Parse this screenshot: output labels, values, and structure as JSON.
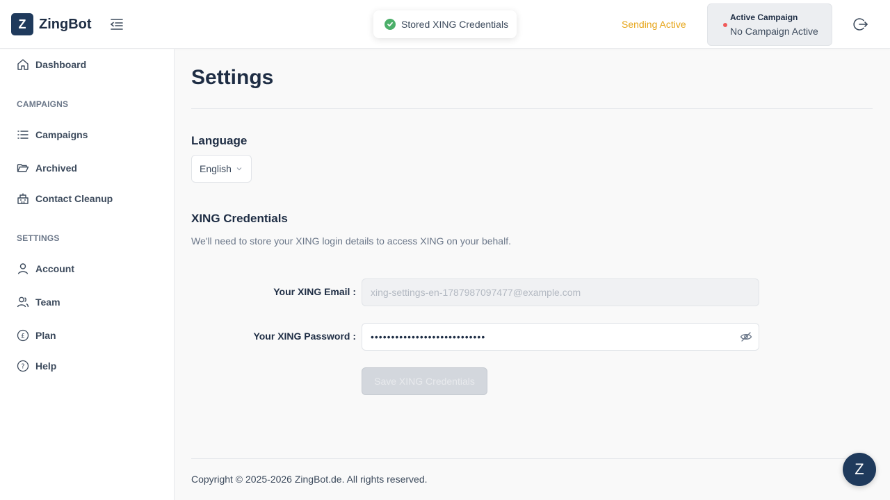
{
  "app": {
    "logo_letter": "Z",
    "name": "ZingBot"
  },
  "toast": {
    "message": "Stored XING Credentials",
    "icon": "check-circle-icon",
    "color": "#4caf6a"
  },
  "header": {
    "status": "Sending Active",
    "status_color": "#e6a417",
    "campaign_title": "Active Campaign",
    "campaign_value": "No Campaign Active",
    "campaign_dot_color": "#f05a5a"
  },
  "sidebar": {
    "dashboard": "Dashboard",
    "campaigns_section": "CAMPAIGNS",
    "items_campaigns": [
      "Campaigns",
      "Archived",
      "Contact Cleanup"
    ],
    "settings_section": "SETTINGS",
    "items_settings": [
      "Account",
      "Team",
      "Plan",
      "Help"
    ]
  },
  "main": {
    "title": "Settings",
    "language_heading": "Language",
    "language_value": "English",
    "credentials_heading": "XING Credentials",
    "credentials_desc": "We'll need to store your XING login details to access XING on your behalf.",
    "email_label": "Your XING Email :",
    "email_placeholder": "xing-settings-en-1787987097477@example.com",
    "password_label": "Your XING Password :",
    "password_value": "••••••••••••••••••••••••••••",
    "save_button": "Save XING Credentials"
  },
  "footer": {
    "copyright": "Copyright © 2025-2026 ZingBot.de. All rights reserved."
  },
  "chat": {
    "letter": "Z"
  },
  "colors": {
    "brand": "#1f3a5c",
    "accent_warning": "#e6a417",
    "success": "#4caf6a"
  }
}
